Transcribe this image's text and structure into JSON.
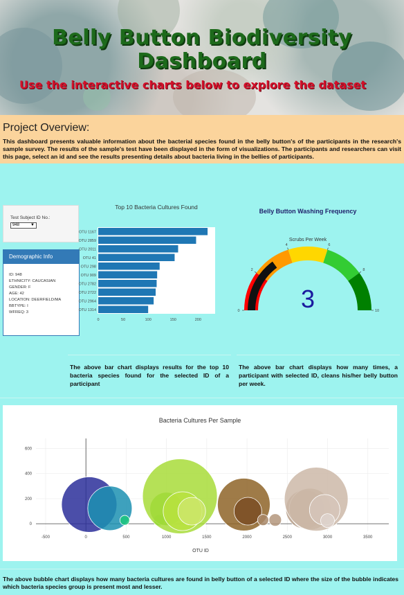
{
  "header": {
    "title_line1": "Belly Button Biodiversity",
    "title_line2": "Dashboard",
    "subtitle": "Use the interactive charts below to explore the dataset"
  },
  "overview": {
    "heading": "Project Overview:",
    "text": "This dashboard presents valuable information about the bacterial species found in the belly button's of the participants in the research's sample survey. The results of the sample's test have been displayed in the form of visualizations. The participants and researchers can visit this page, select an id and see the results presenting details about bacteria living in the bellies of participants."
  },
  "selector": {
    "label": "Test Subject ID No.:",
    "value": "948"
  },
  "demographic": {
    "heading": "Demographic Info",
    "lines": [
      "ID: 948",
      "ETHNICITY: Caucasian",
      "GENDER: F",
      "AGE: 42",
      "LOCATION: Deerfield/MA",
      "BBTYPE: I",
      "WFREQ: 3"
    ]
  },
  "colors": {
    "page_bg": "#9df3ef",
    "overview_bg": "#fbd49c",
    "bar": "#1f77b4",
    "demo_header": "#337ab7",
    "title_green": "#1d6a1b",
    "subtitle_red": "#d4102a",
    "gauge_number": "#1a1a9e"
  },
  "chart_data": [
    {
      "type": "bar",
      "orientation": "horizontal",
      "title": "Top 10 Bacteria Cultures Found",
      "categories": [
        "OTU 1167",
        "OTU 2859",
        "OTU 2011",
        "OTU 41",
        "OTU 298",
        "OTU 909",
        "OTU 2782",
        "OTU 2722",
        "OTU 2964",
        "OTU 1314"
      ],
      "values": [
        219,
        196,
        160,
        153,
        123,
        118,
        117,
        115,
        111,
        100
      ],
      "xticks": [
        "0",
        "50",
        "100",
        "150",
        "200"
      ],
      "xlim": [
        0,
        230
      ]
    },
    {
      "type": "gauge",
      "title": "Belly Button Washing Frequency",
      "subtitle": "Scrubs Per Week",
      "value": 3,
      "range": [
        0,
        10
      ],
      "tick_labels": [
        "0",
        "2",
        "4",
        "6",
        "8",
        "10"
      ],
      "band_colors": [
        "#ff0000",
        "#ff9900",
        "#ffd700",
        "#33cc33",
        "#008000"
      ]
    },
    {
      "type": "scatter",
      "title": "Bacteria Cultures Per Sample",
      "xlabel": "OTU ID",
      "xticks": [
        "-500",
        "0",
        "500",
        "1000",
        "1500",
        "2000",
        "2500",
        "3000",
        "3500"
      ],
      "yticks": [
        "0",
        "200",
        "400",
        "600"
      ],
      "xlim": [
        -620,
        3760
      ],
      "ylim": [
        -60,
        680
      ],
      "points": [
        {
          "x": 41,
          "y": 153,
          "r": 40,
          "color": "#2b2f9a"
        },
        {
          "x": 298,
          "y": 123,
          "r": 32,
          "color": "#1c90b2"
        },
        {
          "x": 482,
          "y": 28,
          "r": 7,
          "color": "#1bc77d"
        },
        {
          "x": 909,
          "y": 28,
          "r": 8,
          "color": "#37c93e"
        },
        {
          "x": 1000,
          "y": 118,
          "r": 24,
          "color": "#70d12a"
        },
        {
          "x": 1167,
          "y": 219,
          "r": 54,
          "color": "#a8dc3a"
        },
        {
          "x": 1200,
          "y": 100,
          "r": 28,
          "color": "#b8e23e"
        },
        {
          "x": 1314,
          "y": 100,
          "r": 20,
          "color": "#cde66b"
        },
        {
          "x": 1960,
          "y": 153,
          "r": 38,
          "color": "#8e6428"
        },
        {
          "x": 2011,
          "y": 100,
          "r": 20,
          "color": "#7a4e24"
        },
        {
          "x": 2200,
          "y": 30,
          "r": 8,
          "color": "#a88767"
        },
        {
          "x": 2350,
          "y": 30,
          "r": 9,
          "color": "#b4977c"
        },
        {
          "x": 2722,
          "y": 115,
          "r": 28,
          "color": "#b59c87"
        },
        {
          "x": 2782,
          "y": 117,
          "r": 30,
          "color": "#c2ad9b"
        },
        {
          "x": 2859,
          "y": 196,
          "r": 46,
          "color": "#cdb8a8"
        },
        {
          "x": 2964,
          "y": 111,
          "r": 22,
          "color": "#d6c6ba"
        },
        {
          "x": 3000,
          "y": 25,
          "r": 10,
          "color": "#ded4ce"
        }
      ]
    }
  ],
  "descriptions": {
    "bar": "The above bar chart displays results for the top 10 bacteria species found for the selected ID of a participant",
    "gauge": "The above bar chart displays how many times, a participant with selected ID, cleans his/her belly button per week.",
    "bubble": "The above bubble chart displays how many bacteria cultures are found in belly button of a selected ID where the size of the bubble indicates which bacteria species group is present most and lesser."
  }
}
